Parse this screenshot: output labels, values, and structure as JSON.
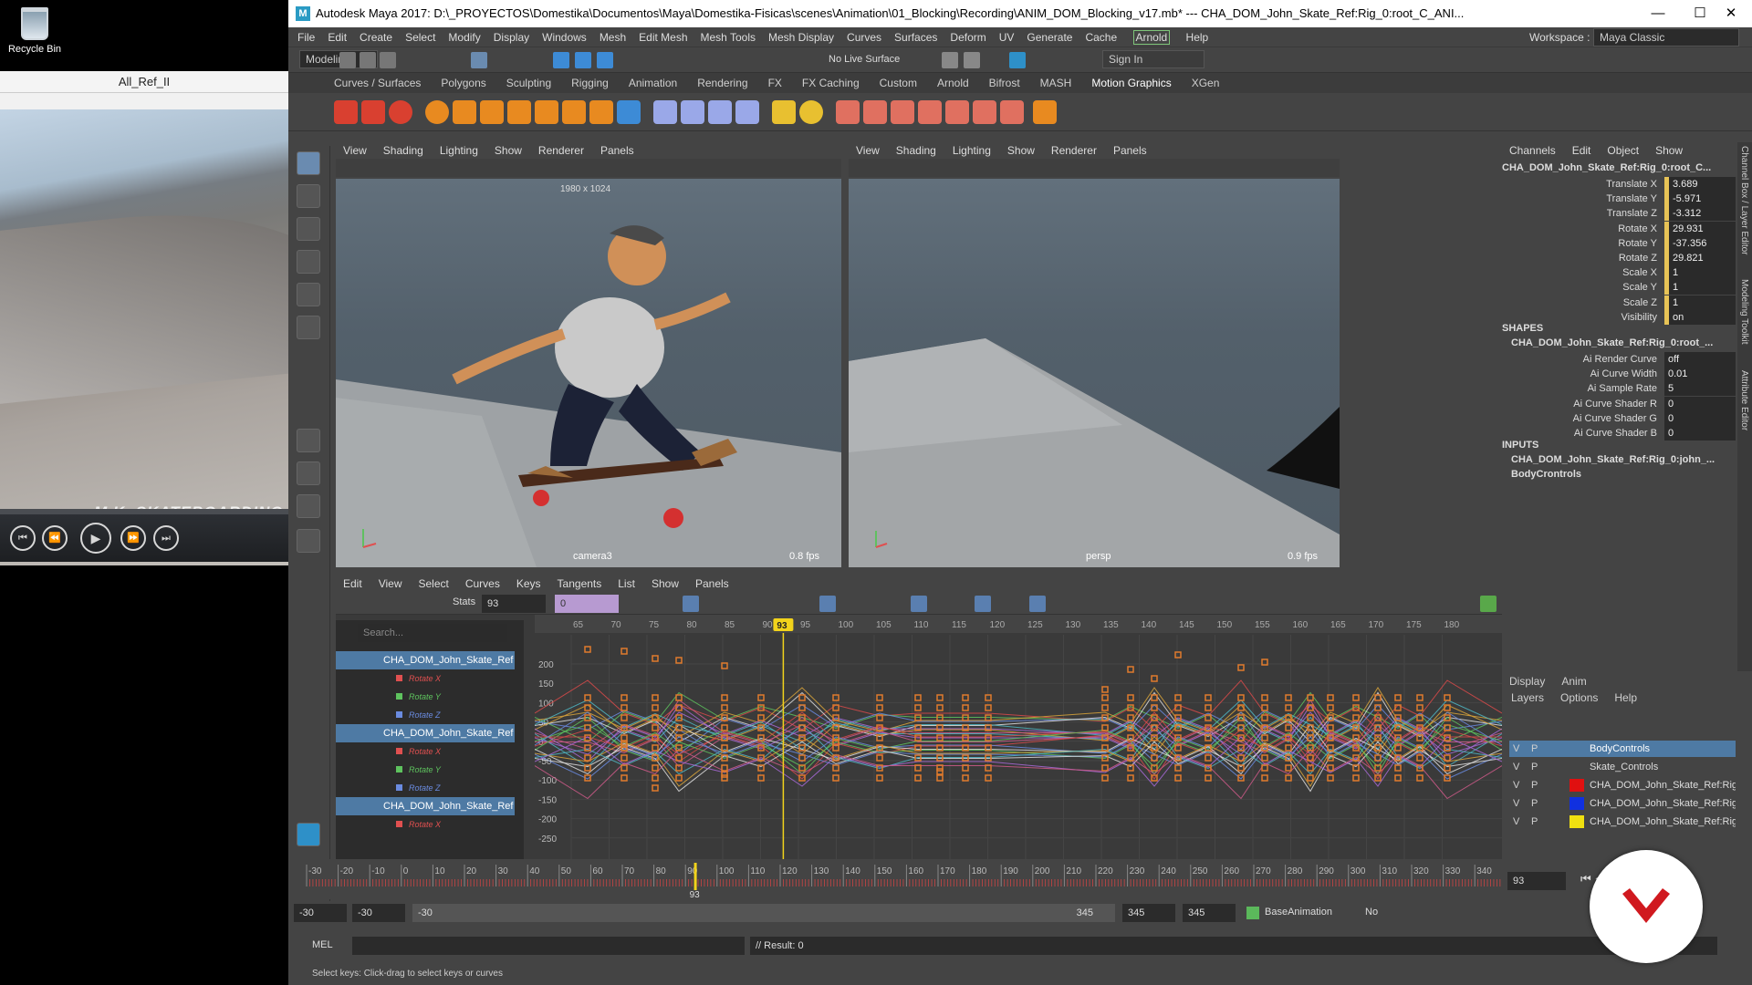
{
  "desktop": {
    "recycle_bin_label": "Recycle Bin"
  },
  "player": {
    "title": "All_Ref_II",
    "watermark": "M.K. SKATEBOARDING CO",
    "controls": {
      "prev": "⏮",
      "rewind": "⏪",
      "play": "▶",
      "forward": "⏩",
      "next": "⏭"
    }
  },
  "maya": {
    "window_title": "Autodesk Maya 2017: D:\\_PROYECTOS\\Domestika\\Documentos\\Maya\\Domestika-Fisicas\\scenes\\Animation\\01_Blocking\\Recording\\ANIM_DOM_Blocking_v17.mb*   ---   CHA_DOM_John_Skate_Ref:Rig_0:root_C_ANI...",
    "window_buttons": {
      "minimize": "—",
      "maximize": "☐",
      "close": "✕"
    },
    "menus": [
      "File",
      "Edit",
      "Create",
      "Select",
      "Modify",
      "Display",
      "Windows",
      "Mesh",
      "Edit Mesh",
      "Mesh Tools",
      "Mesh Display",
      "Curves",
      "Surfaces",
      "Deform",
      "UV",
      "Generate",
      "Cache"
    ],
    "menu_arnold": "Arnold",
    "menu_help": "Help",
    "workspace_label": "Workspace :",
    "workspace_value": "Maya Classic",
    "menuset": "Modeling",
    "live_surface": "No Live Surface",
    "sign_in": "Sign In",
    "shelf_tabs": [
      "Curves / Surfaces",
      "Polygons",
      "Sculpting",
      "Rigging",
      "Animation",
      "Rendering",
      "FX",
      "FX Caching",
      "Custom",
      "Arnold",
      "Bifrost",
      "MASH",
      "Motion Graphics",
      "XGen"
    ],
    "panel_menus": [
      "View",
      "Shading",
      "Lighting",
      "Show",
      "Renderer",
      "Panels"
    ],
    "viewport_left": {
      "resolution": "1980 x 1024",
      "camera": "camera3",
      "fps": "0.8 fps"
    },
    "viewport_right": {
      "camera": "persp",
      "fps": "0.9 fps"
    },
    "channel_box": {
      "menus": [
        "Channels",
        "Edit",
        "Object",
        "Show"
      ],
      "node": "CHA_DOM_John_Skate_Ref:Rig_0:root_C...",
      "channels": [
        {
          "name": "Translate X",
          "value": "3.689"
        },
        {
          "name": "Translate Y",
          "value": "-5.971"
        },
        {
          "name": "Translate Z",
          "value": "-3.312"
        },
        {
          "name": "Rotate X",
          "value": "29.931"
        },
        {
          "name": "Rotate Y",
          "value": "-37.356"
        },
        {
          "name": "Rotate Z",
          "value": "29.821"
        },
        {
          "name": "Scale X",
          "value": "1"
        },
        {
          "name": "Scale Y",
          "value": "1"
        },
        {
          "name": "Scale Z",
          "value": "1"
        },
        {
          "name": "Visibility",
          "value": "on"
        }
      ],
      "shapes_header": "SHAPES",
      "shape_node": "CHA_DOM_John_Skate_Ref:Rig_0:root_...",
      "shape_attrs": [
        {
          "name": "Ai Render Curve",
          "value": "off"
        },
        {
          "name": "Ai Curve Width",
          "value": "0.01"
        },
        {
          "name": "Ai Sample Rate",
          "value": "5"
        },
        {
          "name": "Ai Curve Shader R",
          "value": "0"
        },
        {
          "name": "Ai Curve Shader G",
          "value": "0"
        },
        {
          "name": "Ai Curve Shader B",
          "value": "0"
        }
      ],
      "inputs_header": "INPUTS",
      "input_nodes": [
        "CHA_DOM_John_Skate_Ref:Rig_0:john_...",
        "BodyCrontrols"
      ],
      "side_tabs": [
        "Channel Box / Layer Editor",
        "Modeling Toolkit",
        "Attribute Editor"
      ]
    },
    "graph_editor": {
      "menus": [
        "Edit",
        "View",
        "Select",
        "Curves",
        "Keys",
        "Tangents",
        "List",
        "Show",
        "Panels"
      ],
      "stats_label": "Stats",
      "stats_frame": "93",
      "stats_value": "0",
      "search_placeholder": "Search...",
      "outliner": [
        {
          "kind": "hdr",
          "label": "CHA_DOM_John_Skate_Ref"
        },
        {
          "kind": "ch",
          "label": "Rotate X",
          "color": "#e05050"
        },
        {
          "kind": "ch",
          "label": "Rotate Y",
          "color": "#5ec35e"
        },
        {
          "kind": "ch",
          "label": "Rotate Z",
          "color": "#6a8be0"
        },
        {
          "kind": "hdr",
          "label": "CHA_DOM_John_Skate_Ref"
        },
        {
          "kind": "ch",
          "label": "Rotate X",
          "color": "#e05050"
        },
        {
          "kind": "ch",
          "label": "Rotate Y",
          "color": "#5ec35e"
        },
        {
          "kind": "ch",
          "label": "Rotate Z",
          "color": "#6a8be0"
        },
        {
          "kind": "hdr",
          "label": "CHA_DOM_John_Skate_Ref"
        },
        {
          "kind": "ch",
          "label": "Rotate X",
          "color": "#e05050"
        }
      ],
      "frame_ticks": [
        "65",
        "70",
        "75",
        "80",
        "85",
        "90",
        "95",
        "100",
        "105",
        "110",
        "115",
        "120",
        "125",
        "130",
        "135",
        "140",
        "145",
        "150",
        "155",
        "160",
        "165",
        "170",
        "175",
        "180"
      ],
      "value_ticks": [
        "200",
        "150",
        "100",
        "50",
        "0",
        "-50",
        "-100",
        "-150",
        "-200",
        "-250"
      ],
      "current_frame": "93"
    },
    "layer_editor": {
      "tabs": [
        "Display",
        "Anim"
      ],
      "menus": [
        "Layers",
        "Options",
        "Help"
      ],
      "layers": [
        {
          "v": "V",
          "p": "P",
          "name": "BodyControls",
          "color": "",
          "selected": true
        },
        {
          "v": "V",
          "p": "P",
          "name": "Skate_Controls",
          "color": "",
          "selected": false
        },
        {
          "v": "V",
          "p": "P",
          "name": "CHA_DOM_John_Skate_Ref:Rig",
          "color": "#e01010",
          "selected": false
        },
        {
          "v": "V",
          "p": "P",
          "name": "CHA_DOM_John_Skate_Ref:Rig",
          "color": "#1030e0",
          "selected": false
        },
        {
          "v": "V",
          "p": "P",
          "name": "CHA_DOM_John_Skate_Ref:Rig",
          "color": "#f0e010",
          "selected": false
        }
      ]
    },
    "time_slider": {
      "ticks": [
        "-30",
        "-20",
        "-10",
        "0",
        "10",
        "20",
        "30",
        "40",
        "50",
        "60",
        "70",
        "80",
        "90",
        "100",
        "110",
        "120",
        "130",
        "140",
        "150",
        "160",
        "170",
        "180",
        "190",
        "200",
        "210",
        "220",
        "230",
        "240",
        "250",
        "260",
        "270",
        "280",
        "290",
        "300",
        "310",
        "320",
        "330",
        "340"
      ],
      "current_frame": "93",
      "frame_field": "93"
    },
    "range_slider": {
      "start_anim": "-30",
      "start_playback": "-30",
      "range_start": "-30",
      "range_end": "345",
      "end_playback": "345",
      "end_anim": "345",
      "anim_layer": "BaseAnimation",
      "char_set": "No"
    },
    "command_line": {
      "lang": "MEL",
      "result": "// Result: 0"
    },
    "help_line": "Select keys: Click-drag to select keys or curves"
  },
  "colors": {
    "accent": "#4e7aa4",
    "current_frame": "#f2d31b",
    "keyframe": "#e07b2c"
  }
}
